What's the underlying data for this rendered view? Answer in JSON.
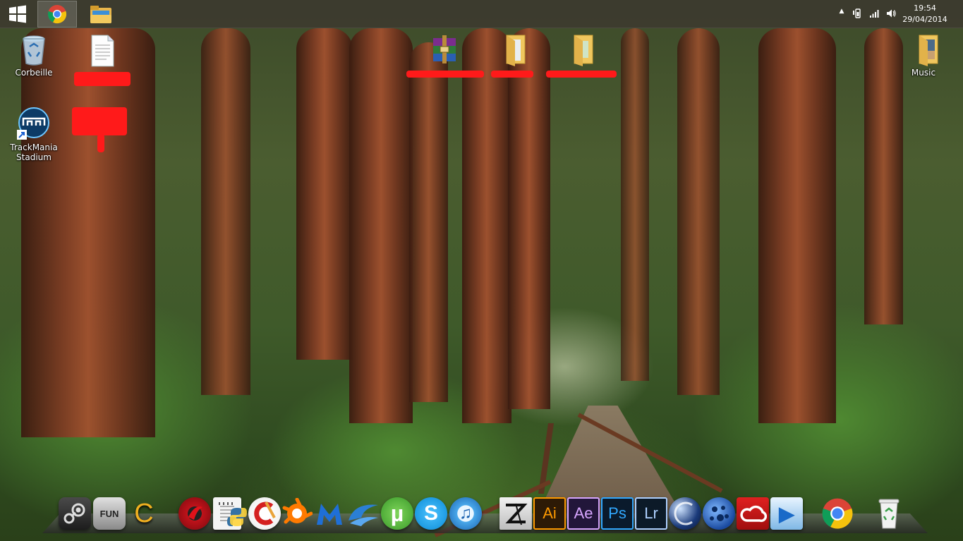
{
  "taskbar": {
    "start_icon": "windows-logo-icon",
    "pinned": [
      {
        "name": "chrome-taskbar-button",
        "icon": "chrome-icon",
        "active": true
      },
      {
        "name": "file-explorer-taskbar-button",
        "icon": "folder-icon",
        "active": false
      }
    ],
    "tray": {
      "chevron": "▲",
      "time": "19:54",
      "date": "29/04/2014"
    }
  },
  "desktop": {
    "icons": [
      {
        "label": "Corbeille",
        "icon": "recycle-bin-icon"
      },
      {
        "label": "TrackMania Stadium",
        "icon": "trackmania-icon"
      },
      {
        "label": "Music",
        "icon": "music-folder-icon"
      }
    ]
  },
  "dock": {
    "items": [
      {
        "name": "steam",
        "icon": "steam-icon"
      },
      {
        "name": "fun",
        "label": "FUN",
        "icon": "fun-drive-icon"
      },
      {
        "name": "ccleaner-c",
        "label": "C",
        "icon": "c-app-icon"
      },
      {
        "name": "red-game",
        "icon": "red-game-icon"
      },
      {
        "name": "notepad",
        "icon": "notepad-icon"
      },
      {
        "name": "python",
        "icon": "python-icon"
      },
      {
        "name": "ccleaner",
        "icon": "ccleaner-icon"
      },
      {
        "name": "avast",
        "icon": "avast-icon"
      },
      {
        "name": "malwarebytes",
        "icon": "malwarebytes-icon"
      },
      {
        "name": "openoffice",
        "icon": "openoffice-icon"
      },
      {
        "name": "utorrent",
        "label": "µ",
        "icon": "utorrent-icon"
      },
      {
        "name": "skype",
        "label": "S",
        "icon": "skype-icon"
      },
      {
        "name": "itunes",
        "label": "♫",
        "icon": "itunes-icon"
      },
      {
        "name": "zbrush",
        "icon": "zbrush-icon"
      },
      {
        "name": "illustrator",
        "label": "Ai",
        "icon": "illustrator-icon"
      },
      {
        "name": "after-effects",
        "label": "Ae",
        "icon": "after-effects-icon"
      },
      {
        "name": "photoshop",
        "label": "Ps",
        "icon": "photoshop-icon"
      },
      {
        "name": "lightroom",
        "label": "Lr",
        "icon": "lightroom-icon"
      },
      {
        "name": "cinema4d",
        "icon": "cinema4d-icon"
      },
      {
        "name": "blue-globe",
        "icon": "globe-icon"
      },
      {
        "name": "creative-cloud",
        "icon": "creative-cloud-icon"
      },
      {
        "name": "media-player",
        "label": "▶",
        "icon": "media-player-icon"
      },
      {
        "name": "chrome",
        "icon": "chrome-icon"
      },
      {
        "name": "recycle-bin",
        "icon": "recycle-bin-icon"
      }
    ]
  },
  "colors": {
    "taskbar": "#3c3730",
    "illustrator_bg": "#2d1a06",
    "illustrator_fg": "#ff9a00",
    "after_effects_bg": "#22163a",
    "after_effects_fg": "#d7a6ff",
    "photoshop_bg": "#0a1a2c",
    "photoshop_fg": "#31a8ff",
    "lightroom_bg": "#0c1a28",
    "lightroom_fg": "#aed0ff",
    "redaction": "#ff1a1a"
  }
}
